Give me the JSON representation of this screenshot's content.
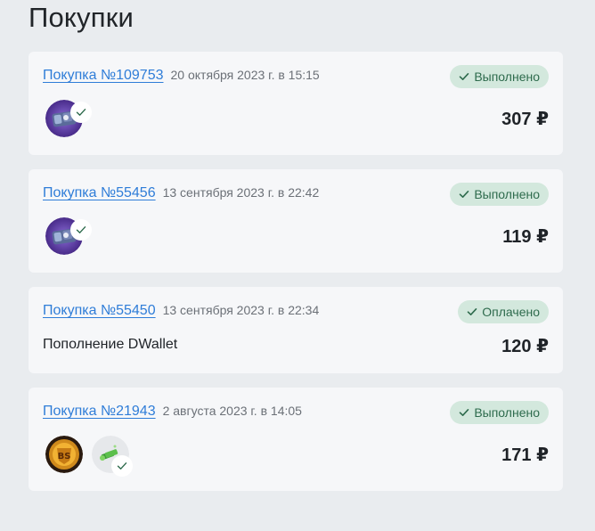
{
  "page": {
    "title": "Покупки"
  },
  "orders": [
    {
      "link_label": "Покупка №109753",
      "date": "20 октября 2023 г. в 15:15",
      "status": "Выполнено",
      "price": "307 ₽",
      "items": [
        "fortnite-skin-pack-icon"
      ]
    },
    {
      "link_label": "Покупка №55456",
      "date": "13 сентября 2023 г. в 22:42",
      "status": "Выполнено",
      "price": "119 ₽",
      "items": [
        "fortnite-skin-pack-icon"
      ]
    },
    {
      "link_label": "Покупка №55450",
      "date": "13 сентября 2023 г. в 22:34",
      "status": "Оплачено",
      "description": "Пополнение DWallet",
      "price": "120 ₽"
    },
    {
      "link_label": "Покупка №21943",
      "date": "2 августа 2023 г. в 14:05",
      "status": "Выполнено",
      "price": "171 ₽",
      "items": [
        "brawl-stars-icon",
        "cash-stack-icon"
      ]
    }
  ],
  "colors": {
    "background": "#e9ecef",
    "card": "#f6f7f9",
    "link": "#2f7dd8",
    "status_bg": "#d3e8dd",
    "status_text": "#2e6b4d"
  }
}
